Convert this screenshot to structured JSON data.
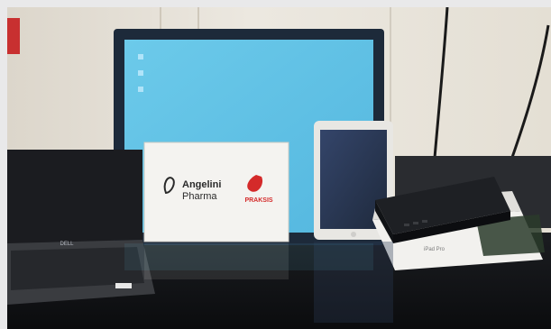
{
  "scene": {
    "brand_primary": "Angelini",
    "brand_secondary": "Pharma",
    "partner_logo": "PRAKSIS",
    "box_label": "iPad Pro",
    "laptop_brand": "DELL"
  },
  "colors": {
    "background_frame": "#e9e9ea",
    "wall": "#e7e2d8",
    "monitor_screen": "#5fc1e6",
    "table": "#131518",
    "praksis_red": "#d42a2a",
    "ipad_screen": "#2b3a52"
  }
}
